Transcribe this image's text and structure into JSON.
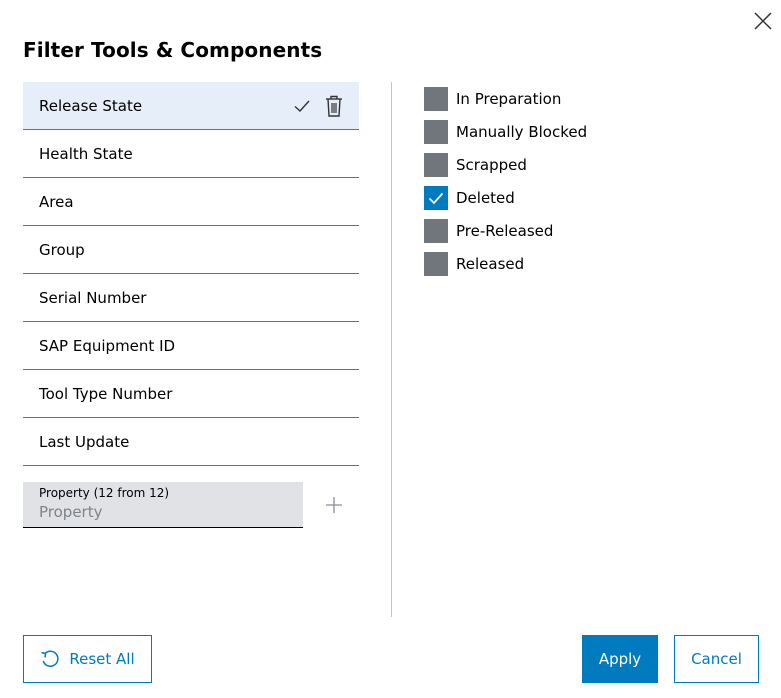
{
  "dialog": {
    "title": "Filter Tools & Components",
    "close_icon": "close-icon"
  },
  "filters": [
    {
      "label": "Release State",
      "active": true
    },
    {
      "label": "Health State",
      "active": false
    },
    {
      "label": "Area",
      "active": false
    },
    {
      "label": "Group",
      "active": false
    },
    {
      "label": "Serial Number",
      "active": false
    },
    {
      "label": "SAP Equipment ID",
      "active": false
    },
    {
      "label": "Tool Type Number",
      "active": false
    },
    {
      "label": "Last Update",
      "active": false
    }
  ],
  "property": {
    "label": "Property (12 from 12)",
    "placeholder": "Property",
    "value": ""
  },
  "options": [
    {
      "label": "In Preparation",
      "checked": false
    },
    {
      "label": "Manually Blocked",
      "checked": false
    },
    {
      "label": "Scrapped",
      "checked": false
    },
    {
      "label": "Deleted",
      "checked": true
    },
    {
      "label": "Pre-Released",
      "checked": false
    },
    {
      "label": "Released",
      "checked": false
    }
  ],
  "footer": {
    "reset_label": "Reset All",
    "apply_label": "Apply",
    "cancel_label": "Cancel"
  },
  "colors": {
    "primary": "#007bc0",
    "active_row": "#e6eef9",
    "checkbox_unchecked": "#71767c",
    "input_background": "#e0e2e5"
  }
}
